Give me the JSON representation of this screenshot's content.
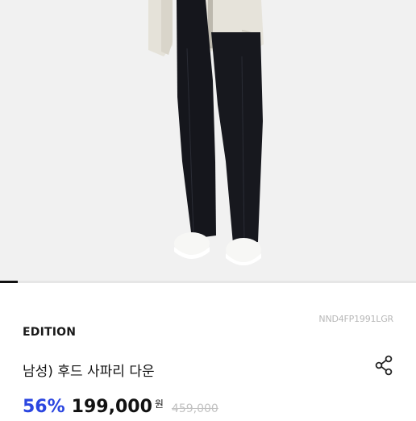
{
  "product": {
    "code": "NND4FP1991LGR",
    "brand": "EDITION",
    "title": "남성) 후드 사파리 다운",
    "discount": "56%",
    "price": "199,000",
    "currency": "원",
    "original_price": "459,000"
  },
  "gallery": {
    "current_index": 1,
    "image_count": 20
  },
  "colors": {
    "discount": "#2b46e0",
    "background": "#f1f1f1"
  },
  "icons": {
    "share": "share-icon"
  }
}
